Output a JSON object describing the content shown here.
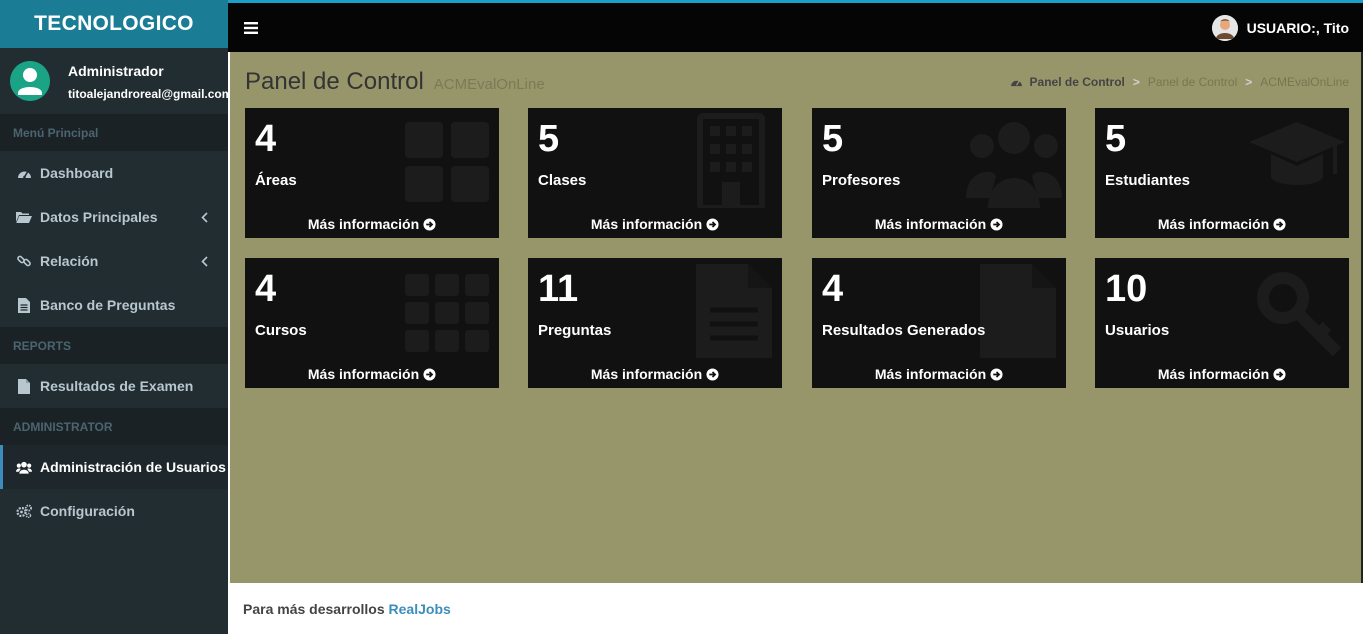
{
  "brand": "TECNOLOGICO",
  "user": {
    "name": "Administrador",
    "email": "titoalejandroreal@gmail.com"
  },
  "sidebar": {
    "header_main": "Menú Principal",
    "items_main": [
      {
        "label": "Dashboard",
        "icon": "dashboard-icon"
      },
      {
        "label": "Datos Principales",
        "icon": "folder-open-icon"
      },
      {
        "label": "Relación",
        "icon": "link-icon"
      },
      {
        "label": "Banco de Preguntas",
        "icon": "file-text-icon"
      }
    ],
    "header_reports": "REPORTS",
    "items_reports": [
      {
        "label": "Resultados de Examen",
        "icon": "file-icon"
      }
    ],
    "header_admin": "ADMINISTRATOR",
    "items_admin": [
      {
        "label": "Administración de Usuarios",
        "icon": "users-icon"
      },
      {
        "label": "Configuración",
        "icon": "cogs-icon"
      }
    ]
  },
  "topbar": {
    "user_label": "USUARIO:, Tito"
  },
  "header": {
    "title": "Panel de Control",
    "subtitle": "ACMEvalOnLine",
    "breadcrumb": [
      "Panel de Control",
      "Panel de Control",
      "ACMEvalOnLine"
    ]
  },
  "boxes": [
    {
      "value": "4",
      "label": "Áreas",
      "more": "Más información"
    },
    {
      "value": "5",
      "label": "Clases",
      "more": "Más información"
    },
    {
      "value": "5",
      "label": "Profesores",
      "more": "Más información"
    },
    {
      "value": "5",
      "label": "Estudiantes",
      "more": "Más información"
    },
    {
      "value": "4",
      "label": "Cursos",
      "more": "Más información"
    },
    {
      "value": "11",
      "label": "Preguntas",
      "more": "Más información"
    },
    {
      "value": "4",
      "label": "Resultados Generados",
      "more": "Más información"
    },
    {
      "value": "10",
      "label": "Usuarios",
      "more": "Más información"
    }
  ],
  "footer": {
    "text": "Para más desarrollos",
    "link": "RealJobs"
  },
  "colors": {
    "brand": "#1b7c95",
    "sidebar": "#222d32",
    "content_bg": "#97966b",
    "box_bg": "#111111",
    "link": "#3c8dbc"
  }
}
